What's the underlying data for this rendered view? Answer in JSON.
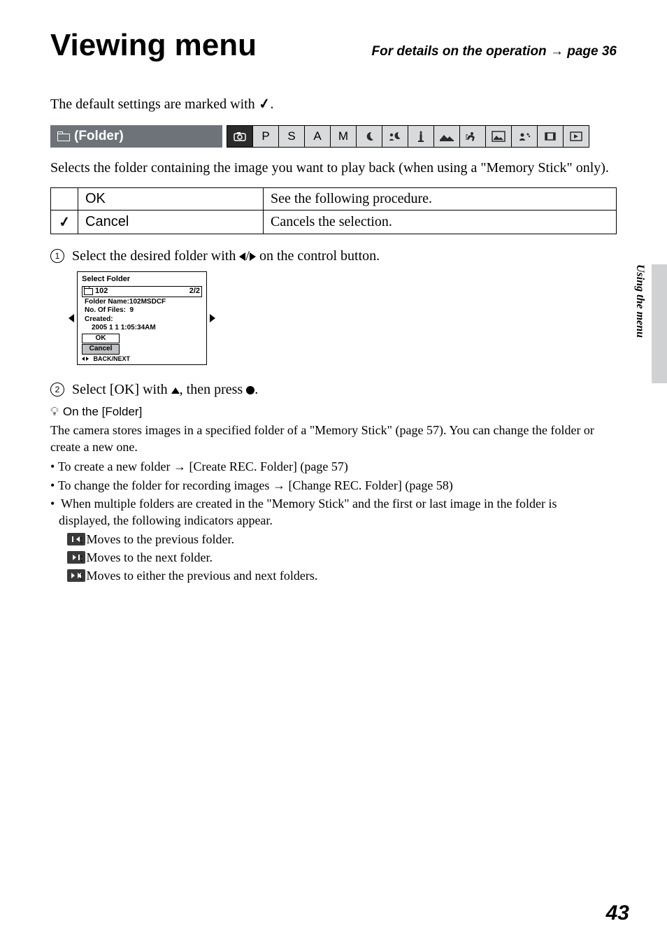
{
  "header": {
    "title": "Viewing menu",
    "subtitle_prefix": "For details on the operation",
    "subtitle_suffix": "page 36"
  },
  "intro": {
    "text_before": "The default settings are marked with ",
    "text_after": "."
  },
  "section": {
    "label": "(Folder)",
    "mode_letters": [
      "P",
      "S",
      "A",
      "M"
    ],
    "desc": "Selects the folder containing the image you want to play back (when using a \"Memory Stick\" only)."
  },
  "options": [
    {
      "default": false,
      "name": "OK",
      "desc": "See the following procedure."
    },
    {
      "default": true,
      "name": "Cancel",
      "desc": "Cancels the selection."
    }
  ],
  "steps": {
    "s1_before": "Select the desired folder with ",
    "s1_mid": "/",
    "s1_after": " on the control button.",
    "s2_before": "Select [OK] with ",
    "s2_mid": ", then press ",
    "s2_after": "."
  },
  "lcd": {
    "title": "Select Folder",
    "folder_num": "102",
    "page": "2/2",
    "folder_name_label": "Folder Name:",
    "folder_name": "102MSDCF",
    "files_label": "No. Of Files:",
    "files": "9",
    "created_label": "Created:",
    "created": "2005   1   1   1:05:34AM",
    "ok": "OK",
    "cancel": "Cancel",
    "foot": "BACK/NEXT"
  },
  "tip": {
    "heading": "On the [Folder]",
    "para": "The camera stores images in a specified folder of a \"Memory Stick\" (page 57). You can change the folder or create a new one.",
    "bullets": [
      {
        "before": "To create a new folder ",
        "after": " [Create REC. Folder] (page 57)"
      },
      {
        "before": "To change the folder for recording images ",
        "after": " [Change REC. Folder] (page 58)"
      }
    ],
    "bullet3a": "When multiple folders are created in the \"Memory Stick\" and the first or last image in the folder is",
    "bullet3b": "displayed, the following indicators appear.",
    "indicators": [
      ": Moves to the previous folder.",
      ": Moves to the next folder.",
      ": Moves to either the previous and next folders."
    ]
  },
  "side": {
    "text": "Using the menu"
  },
  "page_number": "43"
}
